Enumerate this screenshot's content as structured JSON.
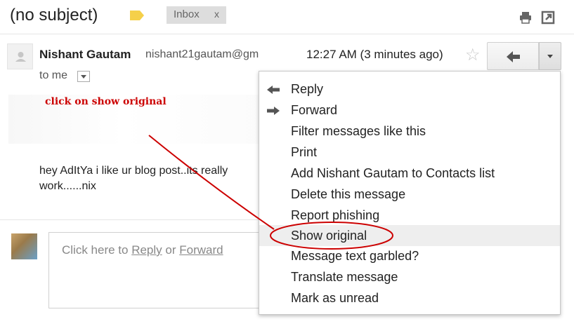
{
  "header": {
    "subject": "(no subject)",
    "label_chip": "Inbox",
    "label_chip_close": "x",
    "icons": [
      "label-tag-icon",
      "print-icon",
      "new-window-icon"
    ]
  },
  "message": {
    "sender_name": "Nishant Gautam",
    "sender_email": "nishant21gautam@gm",
    "timestamp": "12:27 AM (3 minutes ago)",
    "to": "to me",
    "body_lines": [
      "hey AdItYa i like ur blog post..its really",
      "work......nix"
    ]
  },
  "annotation": {
    "text": "click on show original",
    "color": "#cc0000"
  },
  "reply_box": {
    "prefix": "Click here to ",
    "reply_link": "Reply",
    "middle": " or ",
    "forward_link": "Forward"
  },
  "menu": {
    "items": [
      {
        "label": "Reply",
        "icon": "reply-icon"
      },
      {
        "label": "Forward",
        "icon": "forward-arrow-icon"
      },
      {
        "label": "Filter messages like this"
      },
      {
        "label": "Print"
      },
      {
        "label": "Add Nishant Gautam to Contacts list"
      },
      {
        "label": "Delete this message"
      },
      {
        "label": "Report phishing"
      },
      {
        "label": "Show original",
        "highlighted": true
      },
      {
        "label": "Message text garbled?"
      },
      {
        "label": "Translate message"
      },
      {
        "label": "Mark as unread"
      }
    ]
  },
  "colors": {
    "label_tag": "#f5d04a",
    "annotation_red": "#cc0000",
    "highlight": "#eeeeee"
  }
}
